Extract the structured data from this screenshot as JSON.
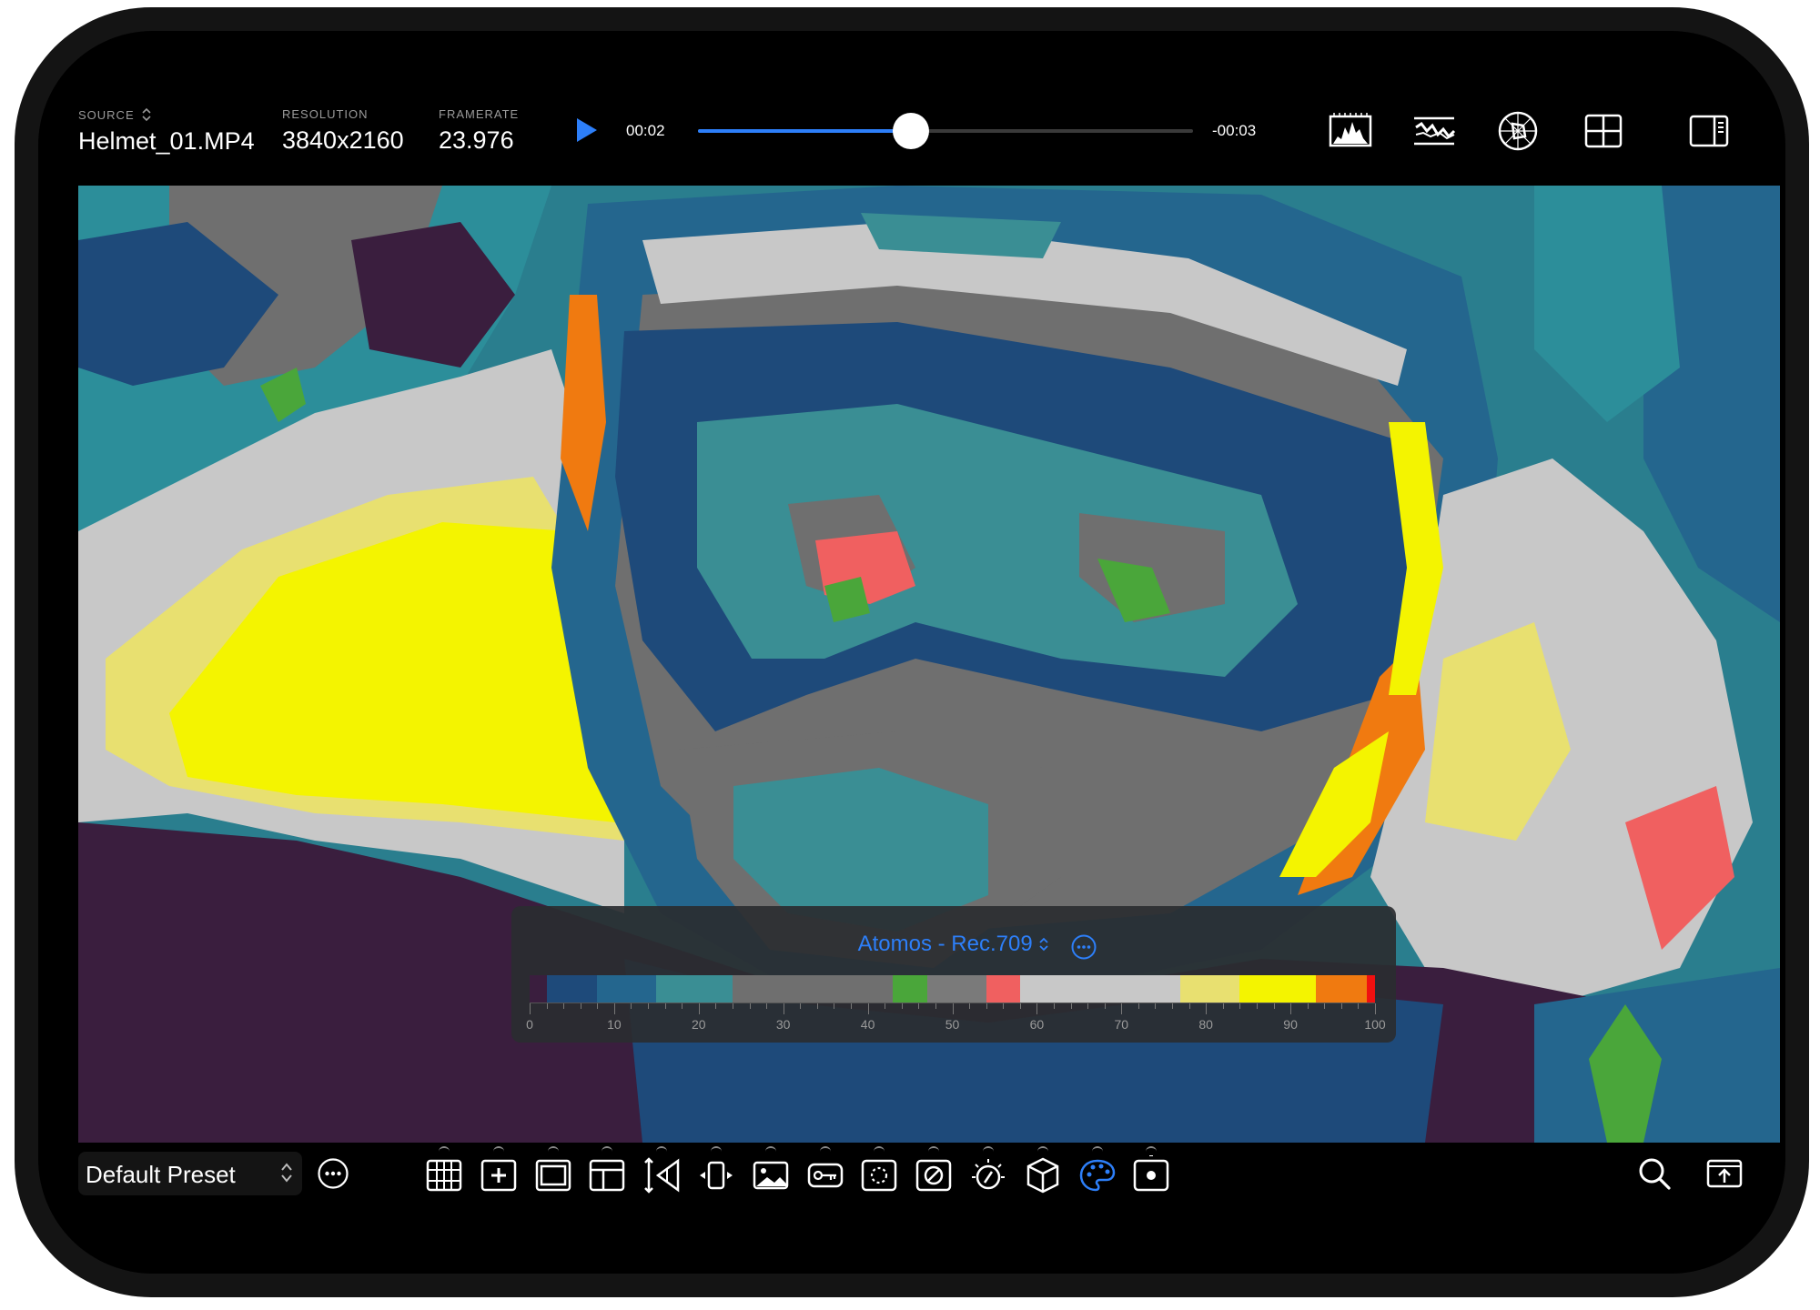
{
  "source": {
    "label": "SOURCE",
    "value": "Helmet_01.MP4"
  },
  "resolution": {
    "label": "RESOLUTION",
    "value": "3840x2160"
  },
  "framerate": {
    "label": "FRAMERATE",
    "value": "23.976"
  },
  "playback": {
    "elapsed": "00:02",
    "remaining": "-00:03",
    "progress": 0.43
  },
  "top_tools": [
    "histogram-icon",
    "waveform-icon",
    "vectorscope-icon",
    "grid-layout-icon",
    "side-panel-icon"
  ],
  "false_color": {
    "title": "Atomos - Rec.709",
    "scale_labels": [
      "0",
      "10",
      "20",
      "30",
      "40",
      "50",
      "60",
      "70",
      "80",
      "90",
      "100"
    ],
    "segments": [
      {
        "from": 0,
        "to": 2,
        "color": "#3a1e3e"
      },
      {
        "from": 2,
        "to": 8,
        "color": "#1e4a7a"
      },
      {
        "from": 8,
        "to": 15,
        "color": "#24668e"
      },
      {
        "from": 15,
        "to": 24,
        "color": "#3a8e94"
      },
      {
        "from": 24,
        "to": 43,
        "color": "#6f6f6f"
      },
      {
        "from": 43,
        "to": 47,
        "color": "#4aa63a"
      },
      {
        "from": 47,
        "to": 54,
        "color": "#7a7a7a"
      },
      {
        "from": 54,
        "to": 58,
        "color": "#f06060"
      },
      {
        "from": 58,
        "to": 77,
        "color": "#c8c8c8"
      },
      {
        "from": 77,
        "to": 84,
        "color": "#e8e070"
      },
      {
        "from": 84,
        "to": 93,
        "color": "#f4f400"
      },
      {
        "from": 93,
        "to": 99,
        "color": "#f07a10"
      },
      {
        "from": 99,
        "to": 100,
        "color": "#f01010"
      }
    ]
  },
  "preset": {
    "label": "Default Preset"
  },
  "toolbar": [
    "grid-overlay-icon",
    "center-marker-icon",
    "frame-guide-icon",
    "safe-area-icon",
    "anamorphic-desqueeze-icon",
    "flip-icon",
    "image-overlay-icon",
    "key-toggle-icon",
    "focus-assist-icon",
    "zebra-icon",
    "exposure-icon",
    "lut-cube-icon",
    "false-color-icon",
    "record-marker-icon"
  ],
  "toolbar_active": "false-color-icon",
  "colors": {
    "accent": "#2d7ff9"
  }
}
